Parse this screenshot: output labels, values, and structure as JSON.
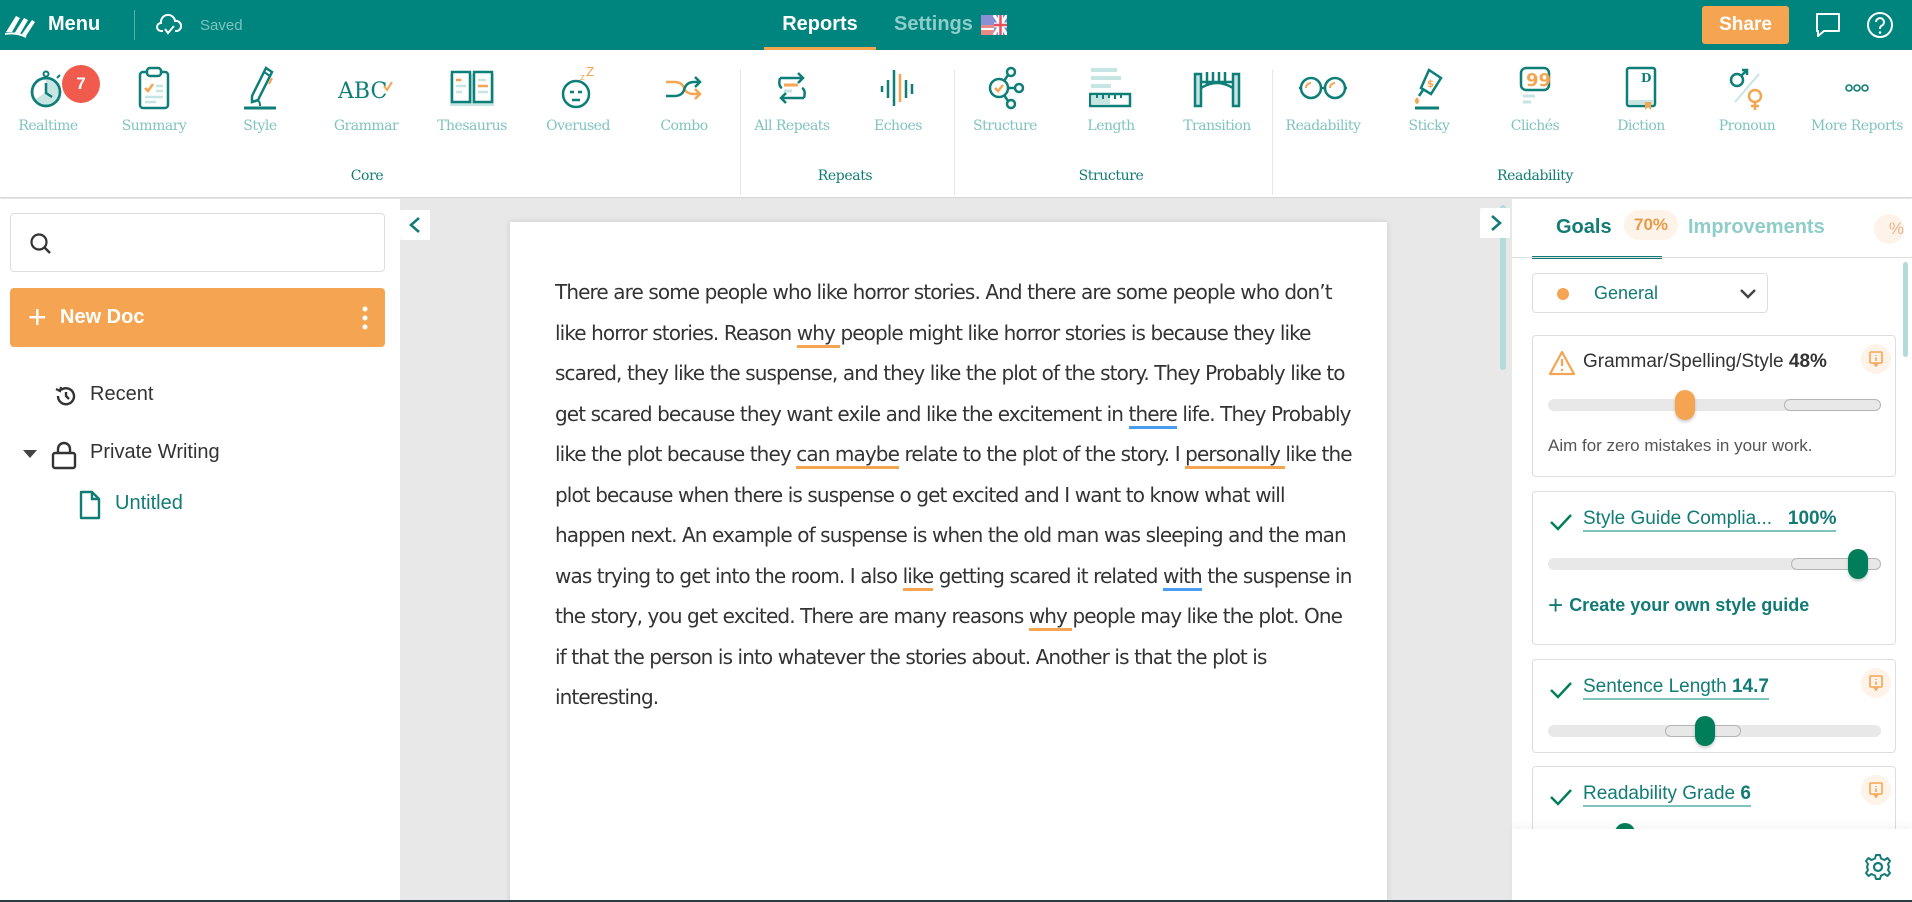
{
  "topbar": {
    "menu_label": "Menu",
    "saved_label": "Saved",
    "nav": [
      {
        "label": "Reports",
        "active": true
      },
      {
        "label": "Settings",
        "active": false
      }
    ],
    "language_flag": "US/UK flag",
    "share_label": "Share",
    "icons": [
      "logo-icon",
      "cloud-check-icon",
      "chat-icon",
      "help-icon"
    ]
  },
  "ribbon": {
    "groups": [
      {
        "label": "Core",
        "tools": [
          {
            "label": "Realtime",
            "icon": "stopwatch-icon",
            "badge": "7"
          },
          {
            "label": "Summary",
            "icon": "clipboard-icon"
          },
          {
            "label": "Style",
            "icon": "pencil-icon"
          },
          {
            "label": "Grammar",
            "icon": "abc-check-icon"
          },
          {
            "label": "Thesaurus",
            "icon": "open-book-icon"
          },
          {
            "label": "Overused",
            "icon": "sleepy-face-icon"
          },
          {
            "label": "Combo",
            "icon": "shuffle-icon"
          }
        ]
      },
      {
        "label": "Repeats",
        "tools": [
          {
            "label": "All Repeats",
            "icon": "repeat-arrows-icon"
          },
          {
            "label": "Echoes",
            "icon": "sound-wave-icon"
          }
        ]
      },
      {
        "label": "Structure",
        "tools": [
          {
            "label": "Structure",
            "icon": "structure-nodes-icon"
          },
          {
            "label": "Length",
            "icon": "ruler-bars-icon"
          },
          {
            "label": "Transition",
            "icon": "bridge-icon"
          }
        ]
      },
      {
        "label": "Readability",
        "tools": [
          {
            "label": "Readability",
            "icon": "glasses-icon"
          },
          {
            "label": "Sticky",
            "icon": "glue-icon"
          },
          {
            "label": "Clichés",
            "icon": "quote-bubble-icon"
          },
          {
            "label": "Diction",
            "icon": "dictionary-icon"
          },
          {
            "label": "Pronoun",
            "icon": "gender-icon"
          },
          {
            "label": "More Reports",
            "icon": "more-dots-icon"
          }
        ]
      }
    ]
  },
  "sidebar": {
    "search_placeholder": "",
    "new_doc_label": "New Doc",
    "items": [
      {
        "label": "Recent",
        "icon": "history-icon"
      },
      {
        "label": "Private Writing",
        "icon": "lock-icon",
        "expanded": true
      },
      {
        "label": "Untitled",
        "icon": "document-icon",
        "active": true
      }
    ]
  },
  "document": {
    "segments": [
      {
        "t": "There are some people who like horror stories. And there are some people who don’t like horror stories. Reason "
      },
      {
        "t": "why ",
        "u": "orange"
      },
      {
        "t": "people might like horror stories is because they like scared, they like the suspense, and they like the plot of the story. They Probably like to get scared because they want exile and like the excitement in "
      },
      {
        "t": "there",
        "u": "blue"
      },
      {
        "t": " life. They Probably like the plot because they "
      },
      {
        "t": "can maybe",
        "u": "orange"
      },
      {
        "t": " relate to the plot of the story. I "
      },
      {
        "t": "personally ",
        "u": "orange"
      },
      {
        "t": "like the plot because when there is suspense o get excited and I want to know what will happen next. An example of suspense is when the old man was sleeping and the man was trying to get into the room. I also "
      },
      {
        "t": "like",
        "u": "orange"
      },
      {
        "t": " getting scared it related "
      },
      {
        "t": "with",
        "u": "blue"
      },
      {
        "t": " the suspense in the story, you get excited. There are many reasons "
      },
      {
        "t": "why ",
        "u": "orange"
      },
      {
        "t": "people may like the plot. One if that the person is into whatever the stories about. Another is that the plot is interesting."
      }
    ]
  },
  "goals_panel": {
    "tabs": [
      {
        "label": "Goals",
        "badge": "70%",
        "active": true
      },
      {
        "label": "Improvements",
        "badge": "%",
        "active": false
      }
    ],
    "goal_type": "General",
    "cards": [
      {
        "status": "warning",
        "title": "Grammar/Spelling/Style",
        "value": "48%",
        "score_fraction": 0.41,
        "target_range": [
          0.71,
          1.0
        ],
        "description": "Aim for zero mistakes in your work."
      },
      {
        "status": "ok",
        "title": "Style Guide Complia...",
        "value": "100%",
        "score_fraction": 0.93,
        "target_range": [
          0.73,
          1.0
        ],
        "action": "Create your own style guide"
      },
      {
        "status": "ok",
        "title": "Sentence Length",
        "value": "14.7",
        "score_fraction": 0.47,
        "target_range": [
          0.35,
          0.58
        ]
      },
      {
        "status": "ok",
        "title": "Readability Grade",
        "value": "6",
        "score_fraction": 0.23
      }
    ]
  },
  "colors": {
    "brand_teal": "#00847e",
    "accent_orange": "#f5a552",
    "badge_red": "#f15b4e",
    "success_green": "#007e5c",
    "underline_blue": "#4a9cf0"
  }
}
